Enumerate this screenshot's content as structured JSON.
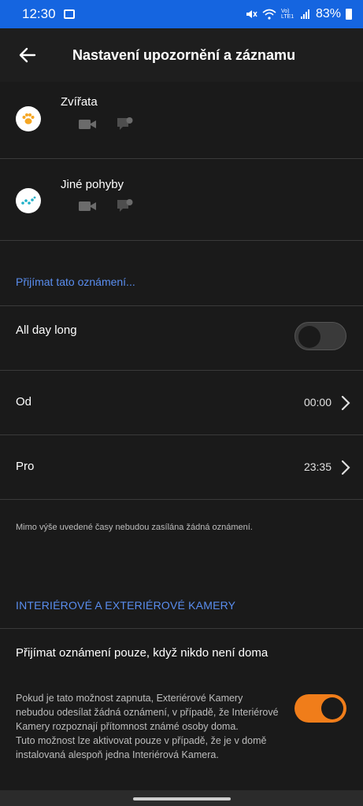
{
  "status_bar": {
    "time": "12:30",
    "battery": "83%",
    "network": "Vo) LTE1"
  },
  "app_bar": {
    "title": "Nastavení upozornění a záznamu"
  },
  "detections": [
    {
      "label": "Zvířata",
      "icon": "paw-icon"
    },
    {
      "label": "Jiné pohyby",
      "icon": "motion-dots-icon"
    }
  ],
  "receive_link": "Přijímat tato oznámení...",
  "schedule": {
    "all_day": {
      "label": "All day long",
      "enabled": false
    },
    "from": {
      "label": "Od",
      "value": "00:00"
    },
    "to": {
      "label": "Pro",
      "value": "23:35"
    },
    "note": "Mimo výše uvedené časy nebudou zasílána žádná oznámení."
  },
  "cameras_section": {
    "header": "INTERIÉROVÉ A EXTERIÉROVÉ KAMERY",
    "only_when_away": {
      "title": "Přijímat oznámení pouze, když nikdo není doma",
      "description": "Pokud je tato možnost zapnuta, Exteriérové Kamery nebudou odesílat žádná oznámení, v případě, že Interiérové Kamery rozpoznají přítomnost známé osoby doma.\nTuto možnost lze aktivovat pouze v případě, že je v domě instalovaná alespoň jedna Interiérová Kamera.",
      "enabled": true
    }
  },
  "colors": {
    "accent": "#f07d1a",
    "link": "#5a8ef0",
    "status_bar": "#1565e0",
    "background": "#1a1a1a"
  }
}
